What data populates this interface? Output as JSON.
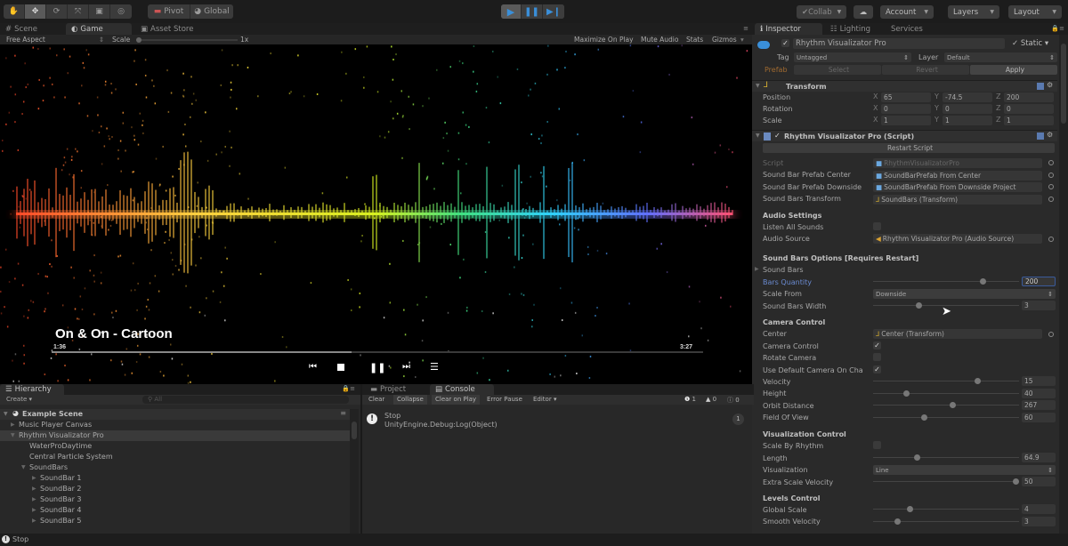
{
  "toolbar": {
    "tools": [
      "hand-tool",
      "move-tool",
      "rotate-tool",
      "scale-tool",
      "rect-tool",
      "transform-tool"
    ],
    "pivot_label": "Pivot",
    "global_label": "Global",
    "collab_label": "Collab",
    "account_label": "Account",
    "layers_label": "Layers",
    "layout_label": "Layout",
    "accent_color": "#3a8fd9"
  },
  "viewtabs": [
    {
      "label": "Scene"
    },
    {
      "label": "Game"
    },
    {
      "label": "Asset Store"
    }
  ],
  "gamebar": {
    "aspect": "Free Aspect",
    "scale_label": "Scale",
    "scale_value": "1x",
    "maximize": "Maximize On Play",
    "mute": "Mute Audio",
    "stats": "Stats",
    "gizmos": "Gizmos"
  },
  "player": {
    "song_title": "On & On - Cartoon",
    "elapsed": "1:36",
    "total": "3:27",
    "progress": 0.46
  },
  "inspector": {
    "tabs": [
      {
        "label": "Inspector"
      },
      {
        "label": "Lighting"
      },
      {
        "label": "Services"
      }
    ],
    "object_name": "Rhythm Visualizator Pro",
    "static_label": "Static",
    "tag_label": "Tag",
    "tag_value": "Untagged",
    "layer_label": "Layer",
    "layer_value": "Default",
    "prefab_label": "Prefab",
    "select_label": "Select",
    "revert_label": "Revert",
    "apply_label": "Apply",
    "transform": {
      "title": "Transform",
      "rows": [
        {
          "label": "Position",
          "x": "65",
          "y": "-74.5",
          "z": "200"
        },
        {
          "label": "Rotation",
          "x": "0",
          "y": "0",
          "z": "0"
        },
        {
          "label": "Scale",
          "x": "1",
          "y": "1",
          "z": "1"
        }
      ]
    },
    "script": {
      "title": "Rhythm Visualizator Pro (Script)",
      "restart_label": "Restart Script",
      "refs": [
        {
          "label": "Script",
          "value": "RhythmVisualizatorPro"
        },
        {
          "label": "Sound Bar Prefab Center",
          "value": "SoundBarPrefab From Center"
        },
        {
          "label": "Sound Bar Prefab Downside",
          "value": "SoundBarPrefab From Downside Project"
        },
        {
          "label": "Sound Bars Transform",
          "value": "SoundBars (Transform)"
        }
      ],
      "audio_settings": "Audio Settings",
      "listen_all_label": "Listen All Sounds",
      "listen_all": false,
      "audio_source_label": "Audio Source",
      "audio_source_value": "Rhythm Visualizator Pro (Audio Source)",
      "sound_bars_options": "Sound Bars Options [Requires Restart]",
      "sound_bars_label": "Sound Bars",
      "bars_quantity_label": "Bars Quantity",
      "bars_quantity": "200",
      "bars_quantity_frac": 0.75,
      "scale_from_label": "Scale From",
      "scale_from": "Downside",
      "bars_width_label": "Sound Bars Width",
      "bars_width": "3",
      "bars_width_frac": 0.3,
      "camera_control": "Camera Control",
      "center_label": "Center",
      "center_value": "Center (Transform)",
      "camera_control_label": "Camera Control",
      "camera_control_on": true,
      "rotate_camera_label": "Rotate Camera",
      "rotate_camera_on": false,
      "use_default_label": "Use Default Camera On Cha",
      "use_default_on": true,
      "camera_sliders": [
        {
          "label": "Velocity",
          "value": "15",
          "frac": 0.71
        },
        {
          "label": "Height",
          "value": "40",
          "frac": 0.21
        },
        {
          "label": "Orbit Distance",
          "value": "267",
          "frac": 0.54
        },
        {
          "label": "Field Of View",
          "value": "60",
          "frac": 0.34
        }
      ],
      "visualization_control": "Visualization Control",
      "scale_by_rhythm_label": "Scale By Rhythm",
      "scale_by_rhythm": false,
      "length_label": "Length",
      "length_value": "64.9",
      "length_frac": 0.29,
      "visualization_label": "Visualization",
      "visualization_value": "Line",
      "extra_scale_label": "Extra Scale Velocity",
      "extra_scale_value": "50",
      "extra_scale_frac": 0.98,
      "levels_control": "Levels Control",
      "levels": [
        {
          "label": "Global Scale",
          "value": "4",
          "frac": 0.24
        },
        {
          "label": "Smooth Velocity",
          "value": "3",
          "frac": 0.15
        }
      ]
    }
  },
  "hierarchy": {
    "title": "Hierarchy",
    "create_label": "Create",
    "search_placeholder": "All",
    "scene": "Example Scene",
    "items": [
      {
        "label": "Music Player Canvas",
        "depth": 1,
        "arrow": "right"
      },
      {
        "label": "Rhythm Visualizator Pro",
        "depth": 1,
        "arrow": "down",
        "selected": true
      },
      {
        "label": "WaterProDaytime",
        "depth": 2,
        "arrow": ""
      },
      {
        "label": "Central Particle System",
        "depth": 2,
        "arrow": ""
      },
      {
        "label": "SoundBars",
        "depth": 2,
        "arrow": "down"
      },
      {
        "label": "SoundBar 1",
        "depth": 3,
        "arrow": "right"
      },
      {
        "label": "SoundBar 2",
        "depth": 3,
        "arrow": "right"
      },
      {
        "label": "SoundBar 3",
        "depth": 3,
        "arrow": "right"
      },
      {
        "label": "SoundBar 4",
        "depth": 3,
        "arrow": "right"
      },
      {
        "label": "SoundBar 5",
        "depth": 3,
        "arrow": "right"
      }
    ]
  },
  "console": {
    "tabs": [
      {
        "label": "Project"
      },
      {
        "label": "Console"
      }
    ],
    "buttons": [
      "Clear",
      "Collapse",
      "Clear on Play",
      "Error Pause",
      "Editor"
    ],
    "log_count": "1",
    "warn_count": "0",
    "error_count": "0",
    "entry_line1": "Stop",
    "entry_line2": "UnityEngine.Debug:Log(Object)",
    "entry_count": "1"
  },
  "status": {
    "text": "Stop"
  }
}
